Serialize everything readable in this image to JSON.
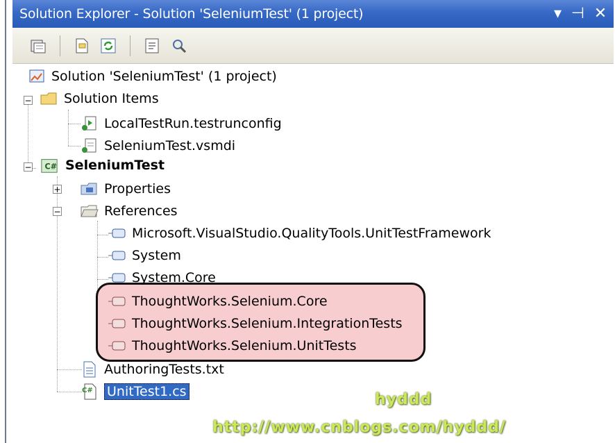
{
  "window": {
    "title": "Solution Explorer - Solution 'SeleniumTest' (1 project)",
    "controls": {
      "dropdown": "▾",
      "pin": "⊣",
      "close": "✕"
    }
  },
  "toolbar": {
    "buttons": [
      "properties-icon",
      "show-all-files-icon",
      "refresh-icon",
      "view-code-icon",
      "view-class-diagram-icon"
    ]
  },
  "tree": {
    "solution": "Solution 'SeleniumTest' (1 project)",
    "solution_items": {
      "label": "Solution Items",
      "children": [
        "LocalTestRun.testrunconfig",
        "SeleniumTest.vsmdi"
      ]
    },
    "project": {
      "label": "SeleniumTest",
      "properties": "Properties",
      "references": {
        "label": "References",
        "children": [
          "Microsoft.VisualStudio.QualityTools.UnitTestFramework",
          "System",
          "System.Core",
          "ThoughtWorks.Selenium.Core",
          "ThoughtWorks.Selenium.IntegrationTests",
          "ThoughtWorks.Selenium.UnitTests"
        ]
      },
      "files": [
        "AuthoringTests.txt",
        "UnitTest1.cs"
      ]
    },
    "selected_item": "UnitTest1.cs"
  },
  "watermark": {
    "name": "hyddd",
    "url": "http://www.cnblogs.com/hyddd/"
  },
  "colors": {
    "titlebar": "#3668c6",
    "selection": "#316ac5",
    "highlight_fill": "#f8cdd0",
    "watermark": "#cde65a"
  }
}
